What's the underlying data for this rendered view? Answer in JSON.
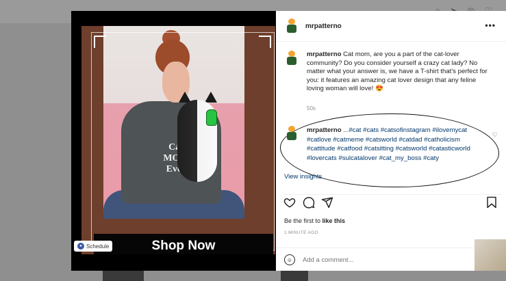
{
  "post": {
    "username": "mrpatterno",
    "cta_label": "Shop Now",
    "schedule_badge": "Schedule",
    "shirt_print": [
      "Cat",
      "MOM",
      "Ever"
    ]
  },
  "caption": {
    "username": "mrpatterno",
    "text": "Cat mom, are you a part of the cat-lover community? Do you consider yourself a crazy cat lady? No matter what your answer is, we have a T-shirt that's perfect for you: it features an amazing cat lover design that any feline loving woman will love! 😍",
    "time": "50s"
  },
  "comment": {
    "username": "mrpatterno",
    "prefix": "...",
    "hashtags": "#cat #cats #catsofinstagram #ilovemycat #catlove #catmeme #catsworld #catdad #catholicism #cattitude #catfood #catsitting #catsworld #catasticworld #lovercats #sulcatalover #cat_my_boss #caty"
  },
  "insights_label": "View insights",
  "likes": {
    "prefix": "Be the first to ",
    "link": "like this"
  },
  "posted_ago": "1 MINUTE AGO",
  "add_comment": {
    "placeholder": "Add a comment..."
  },
  "icons": {
    "more": "more-options-icon",
    "heart": "heart-icon",
    "comment": "comment-icon",
    "share": "share-icon",
    "bookmark": "bookmark-icon",
    "emoji": "emoji-icon",
    "hand_cursor": "hand-cursor-icon"
  }
}
